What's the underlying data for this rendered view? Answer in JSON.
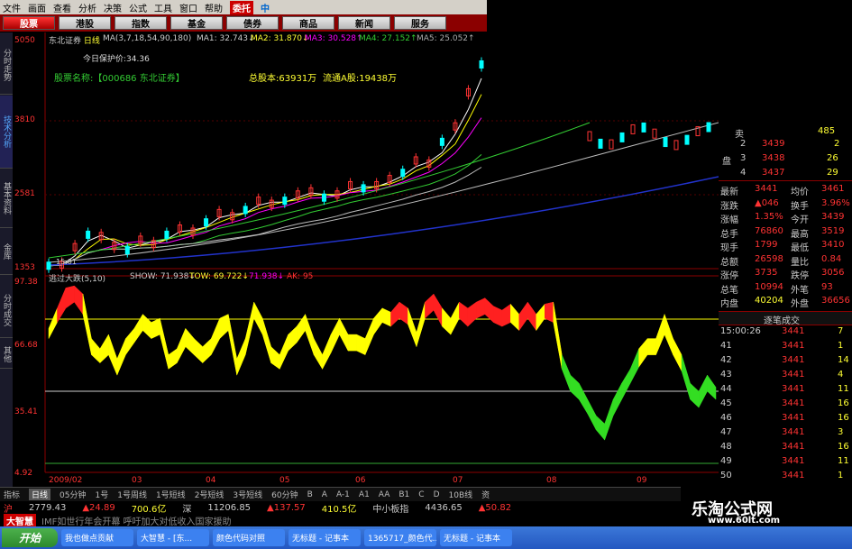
{
  "menu": {
    "items": [
      "文件",
      "画面",
      "查看",
      "分析",
      "决策",
      "公式",
      "工具",
      "窗口",
      "帮助"
    ],
    "brand": "委托",
    "logo_text": "中"
  },
  "nav": {
    "items": [
      "股票",
      "港股",
      "指数",
      "基金",
      "债券",
      "商品",
      "新闻",
      "服务"
    ],
    "active": 0
  },
  "left_tabs": [
    "分时走势",
    "技术分析",
    "基本资料",
    "金库",
    "分时成交",
    "其他"
  ],
  "chart": {
    "header_name": "东北证券",
    "header_period": "日线",
    "ma_text": "MA(3,7,18,54,90,180)",
    "ma1_label": "MA1: 32.743↓",
    "ma2_label": "MA2: 31.870↓",
    "ma3_label": "MA3: 30.528↑",
    "ma4_label": "MA4: 27.152↑",
    "ma5_label": "MA5: 25.052↑",
    "protect_price": "今日保护价:34.36",
    "stock_name": "股票名称:【000686 东北证券】",
    "total_share": "总股本:63931万",
    "float_share": "流通A股:19438万",
    "price_ticks": [
      "5050",
      "3810",
      "2581",
      "1353"
    ],
    "start_label": "15.01",
    "indicator_name": "逃过大跌(5,10)",
    "indicator_vals": [
      "SHOW: 71.938↓",
      "TOW: 69.722↓",
      "71.938↓",
      "AK: 95"
    ],
    "ind_ticks": [
      "97.38",
      "66.68",
      "35.41",
      "4.92"
    ],
    "date_labels": [
      "2009/02",
      "03",
      "04",
      "05",
      "06",
      "07",
      "08",
      "09"
    ],
    "price_line": [
      1400,
      1420,
      1700,
      1900,
      1880,
      1720,
      1650,
      1820,
      1750,
      1900,
      2000,
      1950,
      2100,
      2250,
      2200,
      2300,
      2450,
      2400,
      2450,
      2550,
      2600,
      2500,
      2550,
      2700,
      2650,
      2700,
      2800,
      2900,
      3100,
      3050,
      3400,
      3650,
      4200,
      4650
    ],
    "ind_upper": [
      75,
      85,
      95,
      96,
      92,
      70,
      65,
      72,
      60,
      70,
      75,
      82,
      78,
      80,
      62,
      65,
      75,
      70,
      66,
      70,
      80,
      82,
      60,
      70,
      88,
      80,
      66,
      62,
      72,
      76,
      82,
      70,
      62,
      72,
      80,
      72,
      72,
      70,
      80,
      85,
      83,
      88,
      85,
      73,
      88,
      92,
      85,
      80,
      88,
      85,
      88,
      90,
      86,
      84,
      87,
      82,
      88,
      82,
      87,
      88,
      62,
      52,
      48,
      40,
      32,
      28,
      40,
      48,
      55,
      65,
      70,
      70,
      82,
      70,
      62,
      48,
      44,
      52,
      46
    ],
    "ind_lower": [
      70,
      78,
      85,
      88,
      82,
      62,
      58,
      62,
      52,
      62,
      68,
      74,
      70,
      72,
      55,
      58,
      66,
      62,
      58,
      62,
      70,
      74,
      52,
      62,
      80,
      72,
      58,
      55,
      64,
      68,
      74,
      62,
      55,
      63,
      72,
      64,
      64,
      62,
      72,
      78,
      76,
      80,
      77,
      66,
      80,
      84,
      76,
      72,
      80,
      76,
      80,
      82,
      78,
      76,
      78,
      74,
      80,
      74,
      80,
      78,
      55,
      44,
      40,
      33,
      25,
      20,
      32,
      40,
      48,
      56,
      62,
      62,
      72,
      62,
      54,
      40,
      36,
      44,
      40
    ]
  },
  "chart_data": {
    "type": "line",
    "title": "东北证券 日线",
    "y_ticks": [
      5050,
      3810,
      2581,
      1353
    ],
    "ylim": [
      1353,
      5050
    ],
    "indicator": {
      "name": "逃过大跌(5,10)",
      "y_ticks": [
        97.38,
        66.68,
        35.41,
        4.92
      ]
    }
  },
  "quote": {
    "book": [
      {
        "lvl": "卖",
        "p": "",
        "v": "485"
      },
      {
        "lvl": "2",
        "p": "3439",
        "v": "2"
      },
      {
        "lvl": "3",
        "p": "3438",
        "v": "26"
      },
      {
        "lvl": "4",
        "p": "3437",
        "v": "29"
      },
      {
        "lvl": "5",
        "p": "",
        "v": ""
      }
    ],
    "ask_label": "盘",
    "stats": [
      [
        "最新",
        "3441",
        "均价",
        "3461"
      ],
      [
        "涨跌",
        "▲046",
        "换手",
        "3.96%"
      ],
      [
        "涨幅",
        "1.35%",
        "今开",
        "3439"
      ],
      [
        "总手",
        "76860",
        "最高",
        "3519"
      ],
      [
        "现手",
        "1799",
        "最低",
        "3410"
      ],
      [
        "总额",
        "26598",
        "量比",
        "0.84"
      ],
      [
        "涨停",
        "3735",
        "跌停",
        "3056"
      ],
      [
        "总笔",
        "10994",
        "外笔",
        "93"
      ],
      [
        "内盘",
        "40204",
        "外盘",
        "36656"
      ]
    ],
    "tick_header": "逐笔成交",
    "ticks": [
      [
        "15:00:26",
        "3441",
        "7"
      ],
      [
        "41",
        "3441",
        "1"
      ],
      [
        "42",
        "3441",
        "14"
      ],
      [
        "43",
        "3441",
        "4"
      ],
      [
        "44",
        "3441",
        "11"
      ],
      [
        "45",
        "3441",
        "16"
      ],
      [
        "46",
        "3441",
        "16"
      ],
      [
        "47",
        "3441",
        "3"
      ],
      [
        "48",
        "3441",
        "16"
      ],
      [
        "49",
        "3441",
        "11"
      ],
      [
        "50",
        "3441",
        "1"
      ]
    ]
  },
  "period_bar": {
    "items": [
      "指标",
      "日线",
      "05分钟",
      "1号",
      "1号周线",
      "1号短线",
      "2号短线",
      "3号短线",
      "60分钟",
      "B",
      "A",
      "A-1",
      "A1",
      "AA",
      "B1",
      "C",
      "D",
      "10B线",
      "",
      "资"
    ],
    "current": 1
  },
  "index_bar": {
    "sh_label": "沪",
    "sh_val": "2779.43",
    "sh_chg": "▲24.89",
    "sh_amt": "700.6亿",
    "sz_label": "深",
    "sz_val": "11206.85",
    "sz_chg": "▲137.57",
    "sz_amt": "410.5亿",
    "zx_label": "中小板指",
    "zx_val": "4436.65",
    "zx_chg": "▲50.82"
  },
  "news": {
    "brand": "大智慧",
    "text": "IMF如世行年会开幕 呼吁加大对低收入国家援助"
  },
  "taskbar": {
    "start": "开始",
    "tasks": [
      "我也做点贡献",
      "大智慧 - [东...",
      "颜色代码对照",
      "无标题 - 记事本",
      "1365717_颜色代...",
      "无标题 - 记事本"
    ]
  },
  "watermark": {
    "title": "乐淘公式网",
    "url": "www.60lt.com"
  },
  "colors": {
    "up": "#ff3333",
    "down": "#00ffff",
    "yellow": "#ffff00",
    "green": "#33cc33",
    "ma_blue": "#2233cc",
    "ma_grey": "#bbbbbb"
  }
}
